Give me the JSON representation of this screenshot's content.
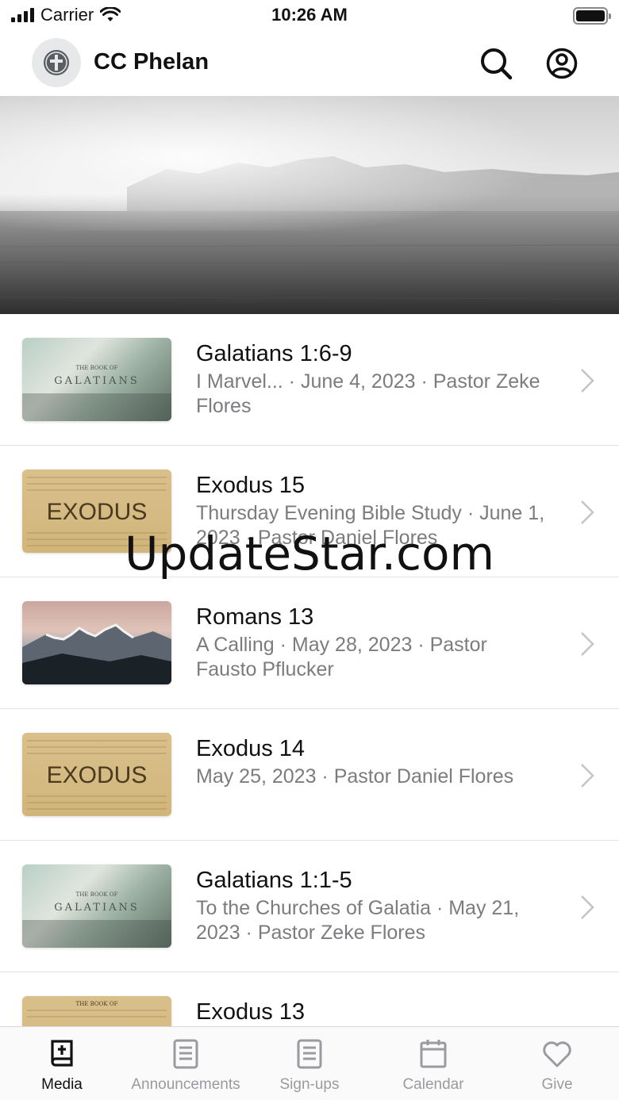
{
  "status_bar": {
    "carrier": "Carrier",
    "time": "10:26 AM"
  },
  "header": {
    "title": "CC Phelan",
    "search_icon": "search-icon",
    "account_icon": "account-icon"
  },
  "media": {
    "items": [
      {
        "title": "Galatians 1:6-9",
        "subtitle": "I Marvel... · June 4, 2023 · Pastor Zeke Flores",
        "thumb": "galatians",
        "thumb_top": "THE BOOK OF",
        "thumb_main": "GALATIANS"
      },
      {
        "title": "Exodus 15",
        "subtitle": "Thursday Evening Bible Study · June 1, 2023 · Pastor Daniel Flores",
        "thumb": "exodus",
        "thumb_main": "EXODUS"
      },
      {
        "title": "Romans 13",
        "subtitle": "A Calling · May 28, 2023 · Pastor Fausto Pflucker",
        "thumb": "mountains"
      },
      {
        "title": "Exodus 14",
        "subtitle": "May 25, 2023 · Pastor Daniel Flores",
        "thumb": "exodus",
        "thumb_main": "EXODUS"
      },
      {
        "title": "Galatians 1:1-5",
        "subtitle": "To the Churches of Galatia · May 21, 2023 · Pastor Zeke Flores",
        "thumb": "galatians",
        "thumb_top": "THE BOOK OF",
        "thumb_main": "GALATIANS"
      },
      {
        "title": "Exodus 13",
        "subtitle": "",
        "thumb": "exodus",
        "thumb_top": "THE BOOK OF"
      }
    ]
  },
  "watermark": "UpdateStar.com",
  "tabs": [
    {
      "label": "Media",
      "icon": "bible-icon",
      "active": true
    },
    {
      "label": "Announcements",
      "icon": "announcements-icon",
      "active": false
    },
    {
      "label": "Sign-ups",
      "icon": "signups-icon",
      "active": false
    },
    {
      "label": "Calendar",
      "icon": "calendar-icon",
      "active": false
    },
    {
      "label": "Give",
      "icon": "heart-icon",
      "active": false
    }
  ],
  "colors": {
    "subtitle": "#7c7c80",
    "active_tab": "#111111",
    "inactive_tab": "#9a9aa0",
    "exodus_parchment": "#d8bf88"
  }
}
